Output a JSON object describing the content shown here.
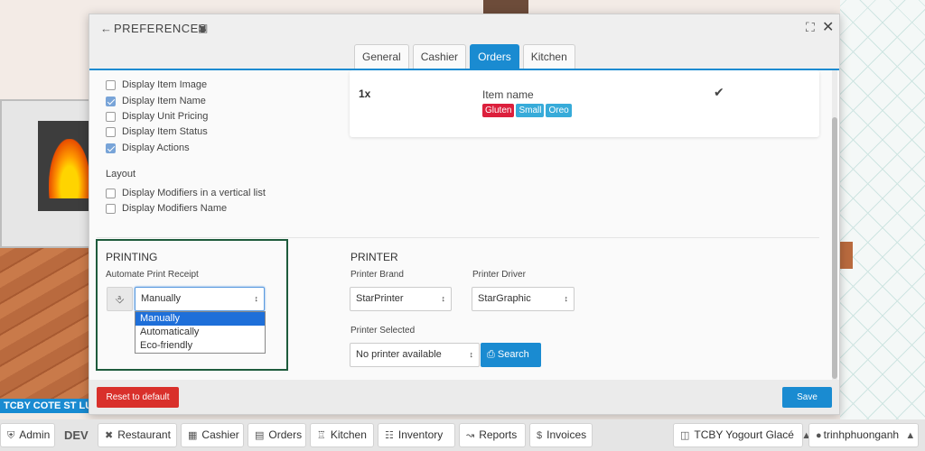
{
  "background": {
    "store_banner": "TCBY COTE ST LUC"
  },
  "modal": {
    "title": "PREFERENCES",
    "tabs": [
      {
        "label": "General",
        "active": false
      },
      {
        "label": "Cashier",
        "active": false
      },
      {
        "label": "Orders",
        "active": true
      },
      {
        "label": "Kitchen",
        "active": false
      }
    ],
    "display_options": [
      {
        "label": "Display Item Image",
        "checked": false
      },
      {
        "label": "Display Item Name",
        "checked": true
      },
      {
        "label": "Display Unit Pricing",
        "checked": false
      },
      {
        "label": "Display Item Status",
        "checked": false
      },
      {
        "label": "Display Actions",
        "checked": true
      }
    ],
    "layout": {
      "label": "Layout",
      "options": [
        {
          "label": "Display Modifiers in a vertical list",
          "checked": false
        },
        {
          "label": "Display Modifiers Name",
          "checked": false
        }
      ]
    },
    "preview": {
      "quantity": "1x",
      "item_name": "Item name",
      "modifiers": [
        {
          "label": "Gluten",
          "color": "#dc1f3c"
        },
        {
          "label": "Small",
          "color": "#37abd9"
        },
        {
          "label": "Oreo",
          "color": "#37abd9"
        }
      ]
    },
    "printing": {
      "title": "PRINTING",
      "automate_label": "Automate Print Receipt",
      "selected": "Manually",
      "options": [
        "Manually",
        "Automatically",
        "Eco-friendly"
      ]
    },
    "printer": {
      "title": "PRINTER",
      "brand_label": "Printer Brand",
      "brand_value": "StarPrinter",
      "driver_label": "Printer Driver",
      "driver_value": "StarGraphic",
      "selected_label": "Printer Selected",
      "selected_value": "No printer available",
      "search_label": "Search"
    },
    "footer": {
      "reset_label": "Reset to default",
      "save_label": "Save"
    }
  },
  "navbar": {
    "admin": "Admin",
    "env": "DEV",
    "items": [
      "Restaurant",
      "Cashier",
      "Orders",
      "Kitchen",
      "Inventory",
      "Reports",
      "Invoices"
    ],
    "store": "TCBY Yogourt Glacé",
    "user": "trinhphuonganh"
  },
  "colors": {
    "accent": "#1a8bd1",
    "danger": "#d9302b",
    "printing_border": "#1e5b3c"
  }
}
